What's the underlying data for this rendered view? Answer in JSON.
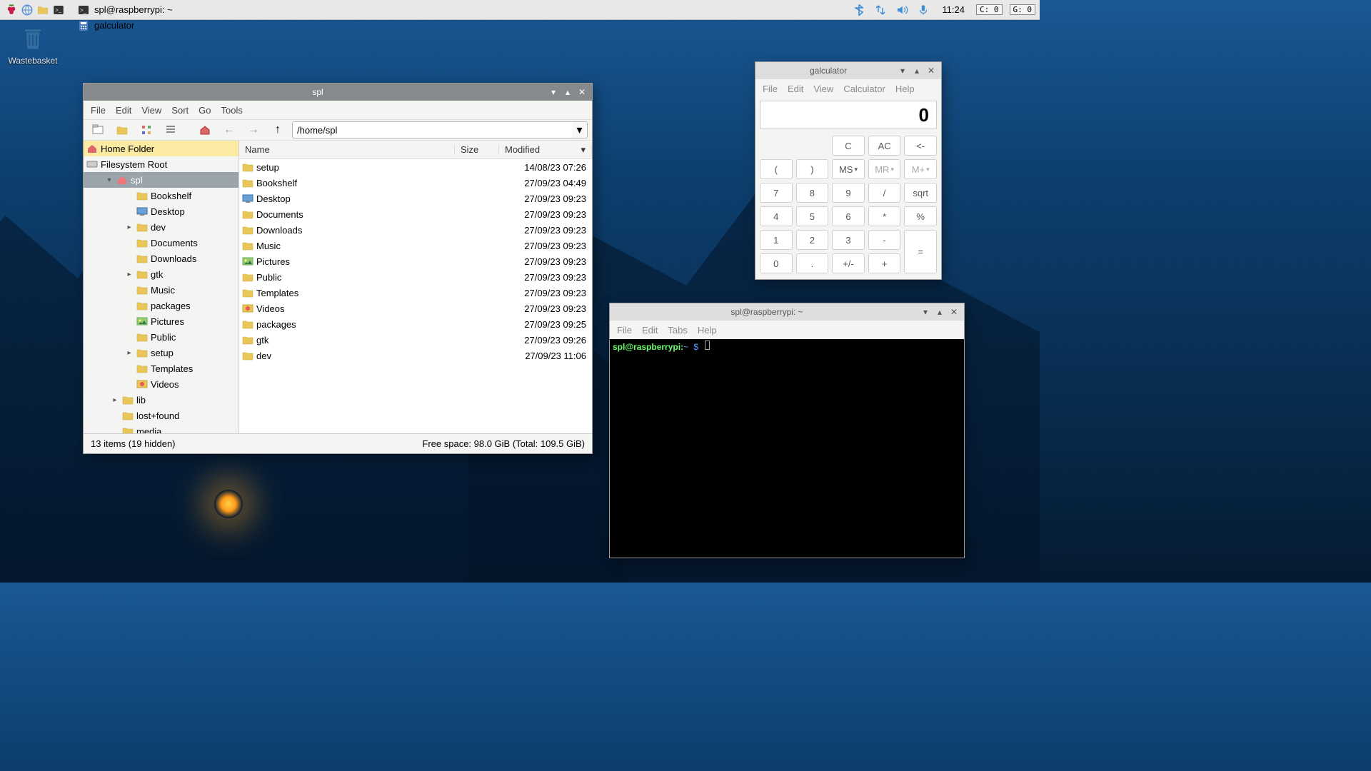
{
  "panel": {
    "tasks": [
      {
        "icon": "folder-icon",
        "label": "spl"
      },
      {
        "icon": "terminal-icon",
        "label": "spl@raspberrypi: ~"
      },
      {
        "icon": "calculator-icon",
        "label": "galculator"
      }
    ],
    "clock": "11:24",
    "cpu_label": "C: 0",
    "gpu_label": "G: 0"
  },
  "desktop": {
    "wastebasket_label": "Wastebasket"
  },
  "fm": {
    "title": "spl",
    "menus": [
      "File",
      "Edit",
      "View",
      "Sort",
      "Go",
      "Tools"
    ],
    "path": "/home/spl",
    "side_home": "Home Folder",
    "side_root": "Filesystem Root",
    "side_spl": "spl",
    "tree": [
      {
        "label": "Bookshelf",
        "exp": ""
      },
      {
        "label": "Desktop",
        "exp": "",
        "icon": "desktop"
      },
      {
        "label": "dev",
        "exp": "▸"
      },
      {
        "label": "Documents",
        "exp": ""
      },
      {
        "label": "Downloads",
        "exp": ""
      },
      {
        "label": "gtk",
        "exp": "▸"
      },
      {
        "label": "Music",
        "exp": ""
      },
      {
        "label": "packages",
        "exp": ""
      },
      {
        "label": "Pictures",
        "exp": "",
        "icon": "pictures"
      },
      {
        "label": "Public",
        "exp": ""
      },
      {
        "label": "setup",
        "exp": "▸"
      },
      {
        "label": "Templates",
        "exp": ""
      },
      {
        "label": "Videos",
        "exp": "",
        "icon": "videos"
      }
    ],
    "tree_after": [
      {
        "label": "lib",
        "exp": "▸"
      },
      {
        "label": "lost+found",
        "exp": ""
      },
      {
        "label": "media",
        "exp": ""
      }
    ],
    "cols": {
      "name": "Name",
      "size": "Size",
      "modified": "Modified"
    },
    "rows": [
      {
        "name": "setup",
        "size": "",
        "modified": "14/08/23 07:26"
      },
      {
        "name": "Bookshelf",
        "size": "",
        "modified": "27/09/23 04:49"
      },
      {
        "name": "Desktop",
        "size": "",
        "modified": "27/09/23 09:23",
        "icon": "desktop"
      },
      {
        "name": "Documents",
        "size": "",
        "modified": "27/09/23 09:23"
      },
      {
        "name": "Downloads",
        "size": "",
        "modified": "27/09/23 09:23"
      },
      {
        "name": "Music",
        "size": "",
        "modified": "27/09/23 09:23"
      },
      {
        "name": "Pictures",
        "size": "",
        "modified": "27/09/23 09:23",
        "icon": "pictures"
      },
      {
        "name": "Public",
        "size": "",
        "modified": "27/09/23 09:23"
      },
      {
        "name": "Templates",
        "size": "",
        "modified": "27/09/23 09:23"
      },
      {
        "name": "Videos",
        "size": "",
        "modified": "27/09/23 09:23",
        "icon": "videos"
      },
      {
        "name": "packages",
        "size": "",
        "modified": "27/09/23 09:25"
      },
      {
        "name": "gtk",
        "size": "",
        "modified": "27/09/23 09:26"
      },
      {
        "name": "dev",
        "size": "",
        "modified": "27/09/23 11:06"
      }
    ],
    "status_left": "13 items (19 hidden)",
    "status_right": "Free space: 98.0 GiB (Total: 109.5 GiB)"
  },
  "calc": {
    "title": "galculator",
    "menus": [
      "File",
      "Edit",
      "View",
      "Calculator",
      "Help"
    ],
    "display": "0",
    "keys_row0": [
      "C",
      "AC",
      "<-"
    ],
    "keys_row1": [
      "(",
      ")",
      "MS",
      "MR",
      "M+"
    ],
    "keys_row2": [
      "7",
      "8",
      "9",
      "/",
      "sqrt"
    ],
    "keys_row3": [
      "4",
      "5",
      "6",
      "*",
      "%"
    ],
    "keys_row4": [
      "1",
      "2",
      "3",
      "-"
    ],
    "equals": "=",
    "keys_row5": [
      "0",
      ".",
      "+/-",
      "+"
    ]
  },
  "term": {
    "title": "spl@raspberrypi: ~",
    "menus": [
      "File",
      "Edit",
      "Tabs",
      "Help"
    ],
    "prompt_user": "spl@raspberrypi",
    "prompt_path": "~",
    "prompt_symbol": "$"
  }
}
